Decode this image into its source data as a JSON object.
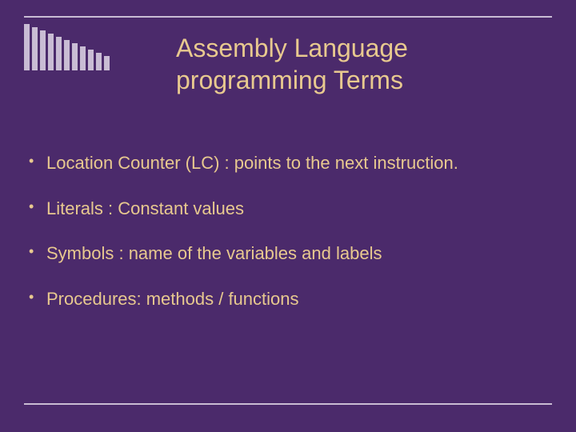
{
  "colors": {
    "background": "#4b2a6b",
    "rule": "#c9bcd4",
    "text": "#e8c98f"
  },
  "title": {
    "line1": "Assembly Language",
    "line2": "programming Terms"
  },
  "bullets": [
    "Location Counter (LC) : points to the next instruction.",
    "Literals : Constant values",
    "Symbols : name of the variables and labels",
    "Procedures: methods / functions"
  ]
}
